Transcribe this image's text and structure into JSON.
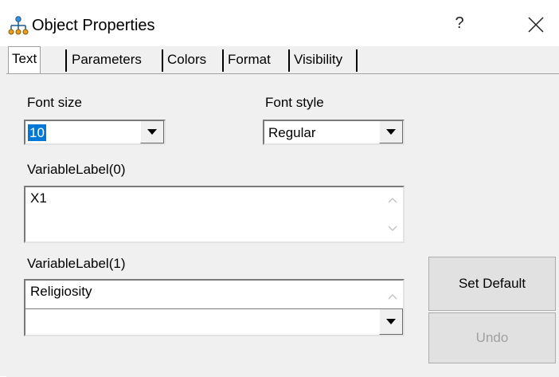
{
  "window": {
    "title": "Object Properties",
    "help_label": "?",
    "app_icon": "hierarchy-diagram-icon",
    "close_icon": "close-icon"
  },
  "tabs": [
    {
      "label": "Text",
      "active": true
    },
    {
      "label": "Parameters",
      "active": false
    },
    {
      "label": "Colors",
      "active": false
    },
    {
      "label": "Format",
      "active": false
    },
    {
      "label": "Visibility",
      "active": false
    }
  ],
  "text_tab": {
    "font_size": {
      "label": "Font size",
      "value": "10"
    },
    "font_style": {
      "label": "Font style",
      "value": "Regular"
    },
    "variable_label_0": {
      "label": "VariableLabel(0)",
      "value": "X1"
    },
    "variable_label_1": {
      "label": "VariableLabel(1)",
      "value": "Religiosity",
      "lower_value": ""
    }
  },
  "buttons": {
    "set_default": "Set Default",
    "undo": "Undo"
  },
  "colors": {
    "selection": "#0078d7",
    "dialog_bg": "#f0f0f0",
    "button_bg": "#e1e1e1",
    "disabled_text": "#a0a0a0"
  }
}
